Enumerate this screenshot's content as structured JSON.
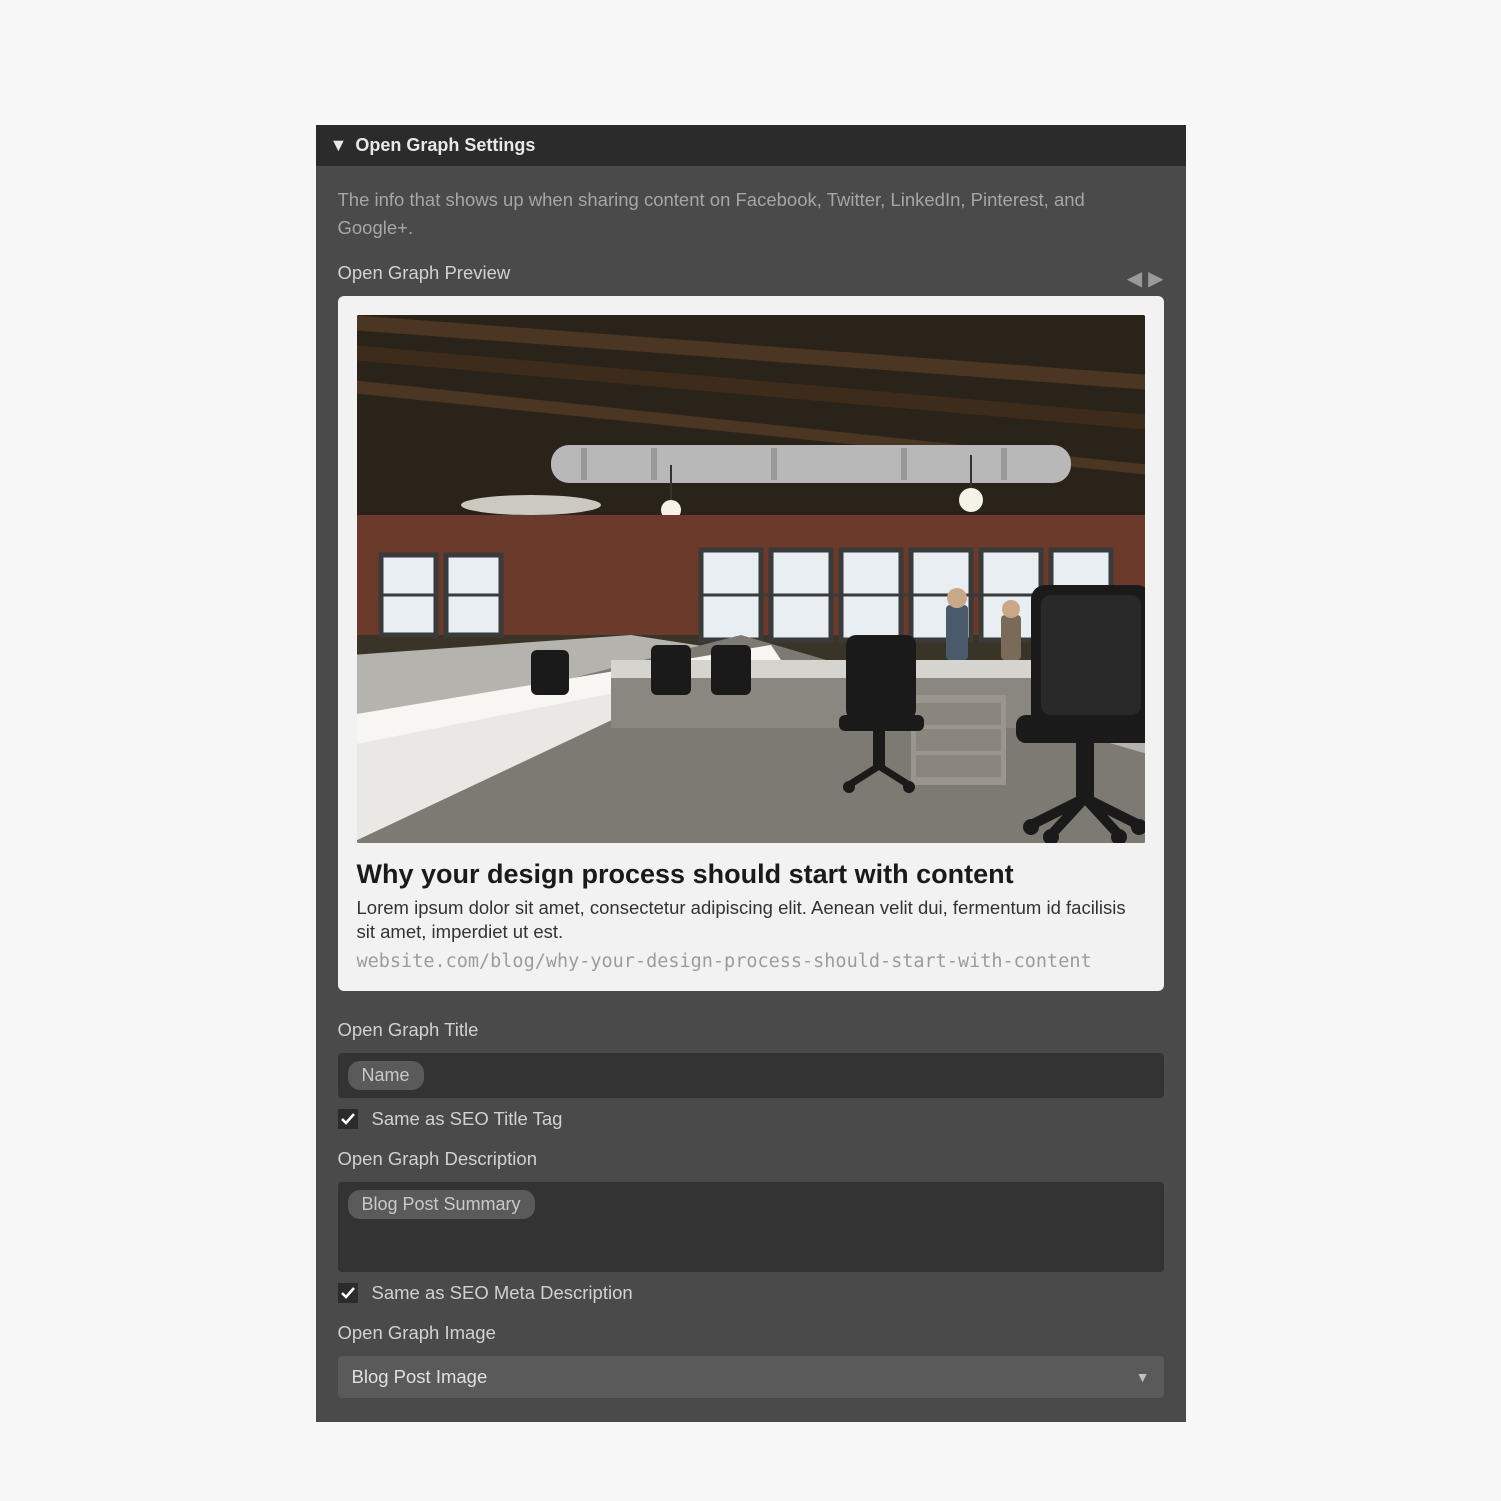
{
  "panel": {
    "title": "Open Graph Settings",
    "info": "The info that shows up when sharing content on Facebook, Twitter, LinkedIn, Pinterest, and Google+."
  },
  "preview": {
    "label": "Open Graph Preview",
    "title": "Why your design process should start with content",
    "description": "Lorem ipsum dolor sit amet, consectetur adipiscing elit. Aenean velit dui, fermentum id facilisis sit amet, imperdiet ut est.",
    "url": "website.com/blog/why-your-design-process-should-start-with-content"
  },
  "fields": {
    "og_title": {
      "label": "Open Graph Title",
      "chip": "Name",
      "checkbox_label": "Same as SEO Title Tag",
      "checked": true
    },
    "og_description": {
      "label": "Open Graph Description",
      "chip": "Blog Post Summary",
      "checkbox_label": "Same as SEO Meta Description",
      "checked": true
    },
    "og_image": {
      "label": "Open Graph Image",
      "value": "Blog Post Image"
    }
  }
}
